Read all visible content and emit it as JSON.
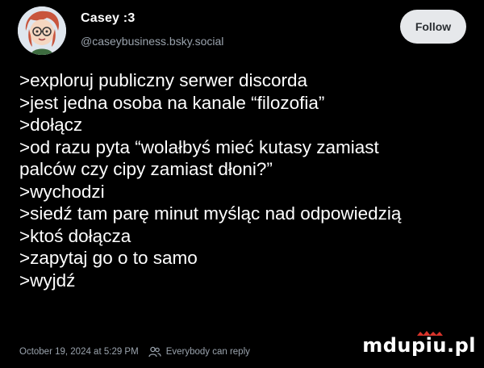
{
  "post": {
    "author_name": "Casey :3",
    "author_handle": "@caseybusiness.bsky.social",
    "follow_label": "Follow",
    "lines": [
      ">exploruj publiczny serwer discorda",
      ">jest jedna osoba na kanale “filozofia”",
      ">dołącz",
      ">od razu pyta “wolałbyś mieć kutasy zamiast",
      "palców czy cipy zamiast dłoni?”",
      ">wychodzi",
      ">siedź tam parę minut myśląc nad odpowiedzią",
      ">ktoś dołącza",
      ">zapytaj go o to samo",
      ">wyjdź"
    ],
    "timestamp": "October 19, 2024 at 5:29 PM",
    "reply_setting": "Everybody can reply"
  },
  "watermark": "mdupiu.pl",
  "icons": {
    "avatar": "cartoon-avatar-icon",
    "people": "people-icon"
  },
  "colors": {
    "background": "#000000",
    "text": "#ffffff",
    "muted": "#9aa3ad",
    "follow_bg": "#e6e8eb"
  }
}
